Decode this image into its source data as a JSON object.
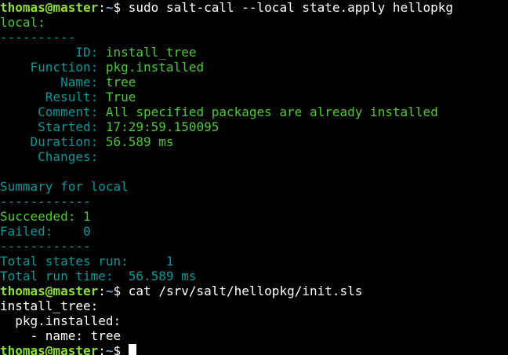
{
  "colors": {
    "background": "#000000",
    "default_text": "#ffffff",
    "prompt_user": "#8ae234",
    "prompt_path": "#729fcf",
    "green": "#4ec934",
    "cyan": "#06989a"
  },
  "prompt": {
    "user_host": "thomas@master",
    "colon": ":",
    "path": "~",
    "symbol": "$ "
  },
  "commands": {
    "first": "sudo salt-call --local state.apply hellopkg",
    "second": "cat /srv/salt/hellopkg/init.sls"
  },
  "output": {
    "local": "local:",
    "divider_long": "----------",
    "state": [
      {
        "label": "          ID: ",
        "value": "install_tree"
      },
      {
        "label": "    Function: ",
        "value": "pkg.installed"
      },
      {
        "label": "        Name: ",
        "value": "tree"
      },
      {
        "label": "      Result: ",
        "value": "True"
      },
      {
        "label": "     Comment: ",
        "value": "All specified packages are already installed"
      },
      {
        "label": "     Started: ",
        "value": "17:29:59.150095"
      },
      {
        "label": "    Duration: ",
        "value": "56.589 ms"
      },
      {
        "label": "     Changes: ",
        "value": ""
      }
    ],
    "summary_title": "Summary for local",
    "divider_short": "------------",
    "succeeded": "Succeeded: 1",
    "failed": "Failed:    0",
    "total_states": "Total states run:     1",
    "total_time": "Total run time:  56.589 ms"
  },
  "file_contents": [
    "install_tree:",
    "  pkg.installed:",
    "    - name: tree"
  ]
}
